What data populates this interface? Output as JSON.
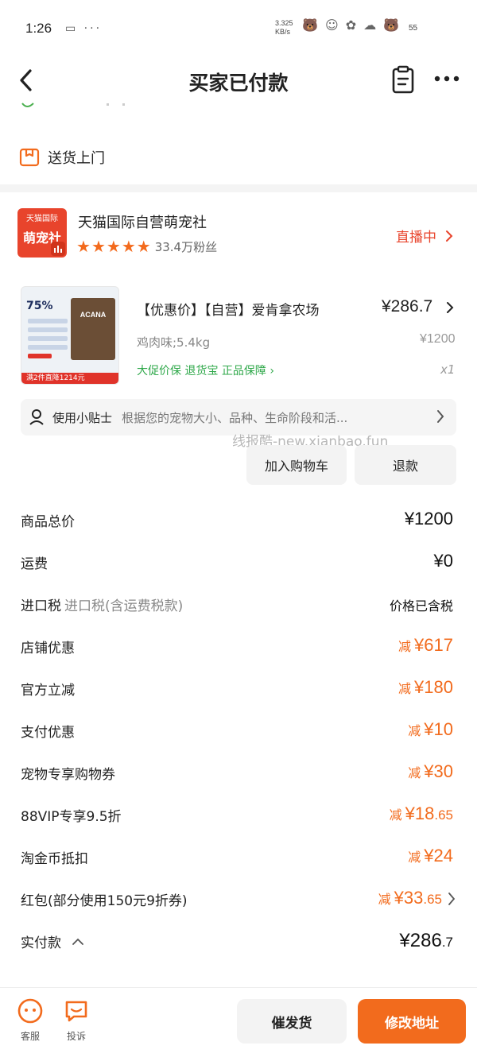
{
  "status_bar": {
    "time": "1:26",
    "icons": "▭ ···",
    "net_speed": "3.325",
    "net_unit": "KB/s",
    "deco": "🐻 ☺ ✿ ☁ 🐻",
    "battery": "55"
  },
  "nav": {
    "title": "买家已付款"
  },
  "delivery": {
    "label": "送货上门"
  },
  "shop": {
    "logo_top": "天猫国际",
    "logo_main": "萌宠社",
    "name": "天猫国际自营萌宠社",
    "fans": "33.4万粉丝",
    "live_label": "直播中"
  },
  "product": {
    "image_percent": "75%",
    "image_bag_text": "ACANA",
    "image_strip": "满2件直降1214元",
    "title": "【优惠价】【自营】爱肯拿农场",
    "price": "¥286.7",
    "spec": "鸡肉味;5.4kg",
    "original_price": "¥1200",
    "services": "大促价保  退货宝  正品保障 ›",
    "quantity": "x1"
  },
  "tips": {
    "label": "使用小贴士",
    "text": "根据您的宠物大小、品种、生命阶段和活..."
  },
  "watermark": "线报酷-new.xianbao.fun",
  "buttons": {
    "add_cart": "加入购物车",
    "refund": "退款"
  },
  "fees": [
    {
      "key": "商品总价",
      "value": "¥1200",
      "color": "#111111"
    },
    {
      "key": "运费",
      "value": "¥0",
      "color": "#111111"
    },
    {
      "key": "进口税",
      "sub": "进口税(含运费税款)",
      "value": "价格已含税",
      "color": "#111111"
    },
    {
      "key": "店铺优惠",
      "prefix": "减",
      "value": "¥617",
      "color": "#f26b1d"
    },
    {
      "key": "官方立减",
      "prefix": "减",
      "value": "¥180",
      "color": "#f26b1d"
    },
    {
      "key": "支付优惠",
      "prefix": "减",
      "value": "¥10",
      "color": "#f26b1d"
    },
    {
      "key": "宠物专享购物券",
      "prefix": "减",
      "value": "¥30",
      "color": "#f26b1d"
    },
    {
      "key": "88VIP专享9.5折",
      "prefix": "减",
      "value_main": "¥18",
      "value_cents": ".65",
      "color": "#f26b1d"
    },
    {
      "key": "淘金币抵扣",
      "prefix": "减",
      "value": "¥24",
      "color": "#f26b1d"
    },
    {
      "key": "红包(部分使用150元9折券)",
      "prefix": "减",
      "value_main": "¥33",
      "value_cents": ".65",
      "color": "#f26b1d"
    },
    {
      "key": "实付款",
      "value_main": "¥286",
      "value_cents": ".7",
      "color": "#111111"
    }
  ],
  "bottom": {
    "service": "客服",
    "complain": "投诉",
    "delay": "催发货",
    "modify_address": "修改地址"
  },
  "colors": {
    "accent": "#f26b1d",
    "brand_red": "#e8442c",
    "green": "#2fa84a"
  }
}
